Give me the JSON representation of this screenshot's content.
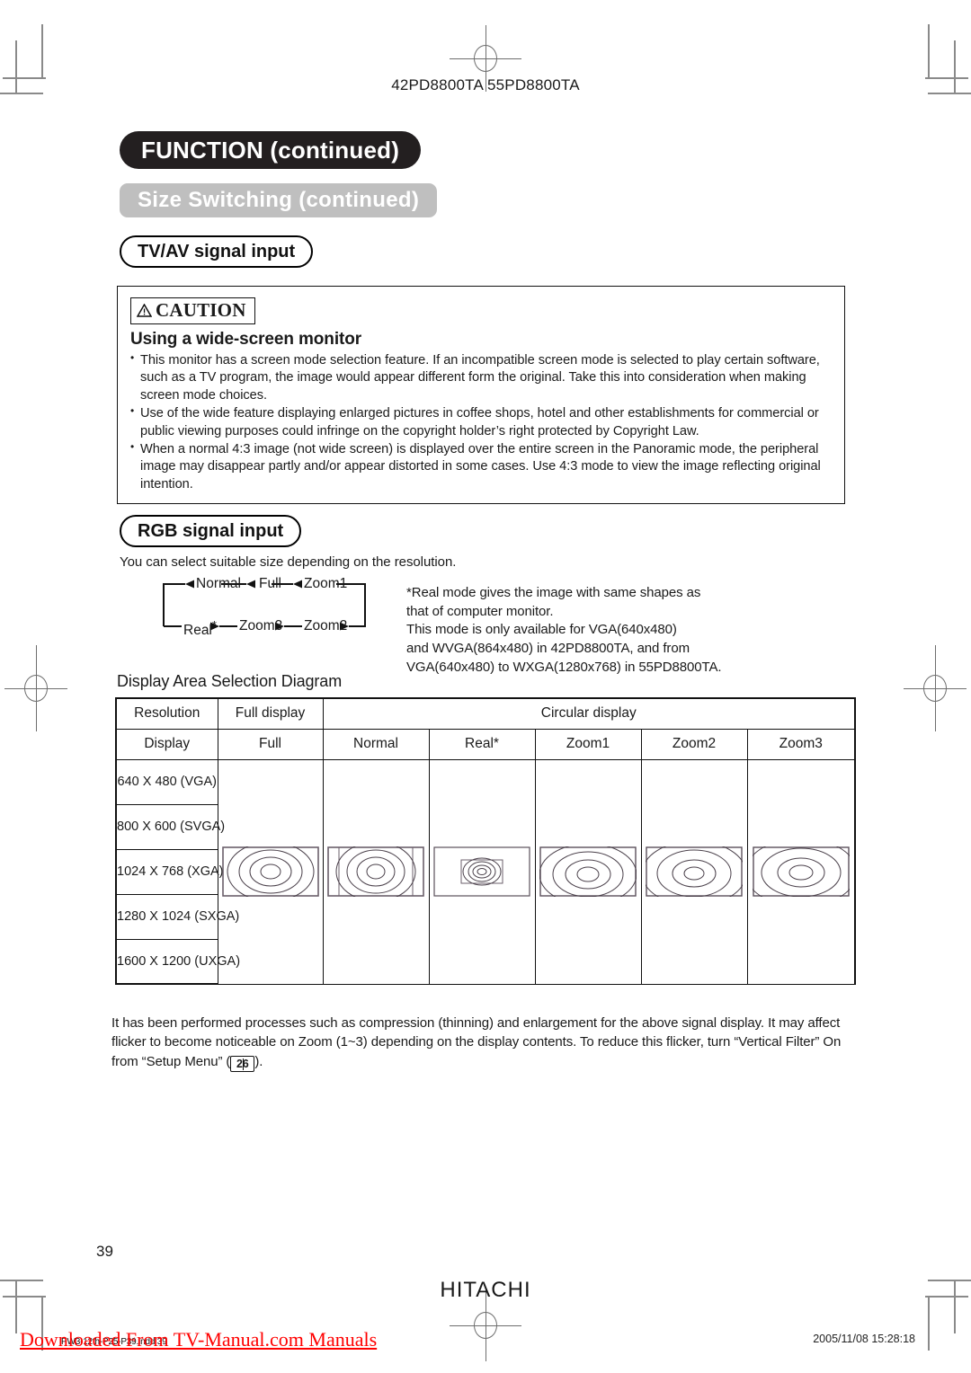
{
  "model_line": "42PD8800TA  55PD8800TA",
  "headers": {
    "function": "FUNCTION (continued)",
    "size_switching": "Size Switching (continued)",
    "tv_av": "TV/AV signal input",
    "rgb": "RGB signal input"
  },
  "caution": {
    "badge": "CAUTION",
    "subtitle": "Using a wide-screen monitor",
    "bullets": [
      "This monitor has a screen mode selection feature. If an incompatible screen mode is selected to play certain software, such as a TV program, the image would appear different form the original. Take this into consideration when making screen mode choices.",
      "Use of the wide feature displaying enlarged pictures in coffee shops, hotel and other establishments for commercial or public viewing purposes could infringe on the copyright holder’s right protected by Copyright Law.",
      "When a normal 4:3 image (not wide screen) is displayed over the entire screen in the Panoramic mode, the peripheral image may disappear partly and/or appear distorted in some cases. Use 4:3 mode to view the image reflecting original intention."
    ]
  },
  "rgb_section": {
    "description": "You can select suitable size depending on the resolution.",
    "flow_top": [
      "Normal",
      "Full",
      "Zoom1"
    ],
    "flow_bottom": [
      "Real",
      "Zoom3",
      "Zoom2"
    ],
    "flow_real_marker": "*",
    "note_lines": [
      "*Real mode gives the image with same shapes as",
      " that of computer monitor.",
      "This mode is only available for VGA(640x480)",
      "and WVGA(864x480) in 42PD8800TA, and from",
      "VGA(640x480) to WXGA(1280x768) in 55PD8800TA."
    ]
  },
  "diagram": {
    "title": "Display Area Selection Diagram",
    "group_headers": [
      "Resolution",
      "Full display",
      "Circular display"
    ],
    "column_headers": [
      "Display",
      "Full",
      "Normal",
      "Real*",
      "Zoom1",
      "Zoom2",
      "Zoom3"
    ],
    "resolutions": [
      "640 X 480 (VGA)",
      "800 X 600 (SVGA)",
      "1024 X 768 (XGA)",
      "1280 X 1024 (SXGA)",
      "1600 X 1200 (UXGA)"
    ]
  },
  "bottom_note": {
    "text_before": "It has been performed processes such as compression (thinning) and enlargement for the above signal display. It may affect flicker to become noticeable on Zoom (1~3) depending on the display contents. To reduce this flicker, turn “Vertical Filter” On from “Setup Menu” (",
    "page_ref": "26",
    "text_after": ")."
  },
  "footer": {
    "page_number": "39",
    "brand": "HITACHI",
    "timestamp": "2005/11/08  15:28:18",
    "indd_file": "PW3-12th-P25-P39.indd  39",
    "watermark": "Downloaded From TV-Manual.com Manuals"
  },
  "colors": {
    "function_pill_bg": "#231f20",
    "size_pill_bg": "#bfbfbf",
    "watermark": "#ff0000",
    "rule": "#111111"
  }
}
